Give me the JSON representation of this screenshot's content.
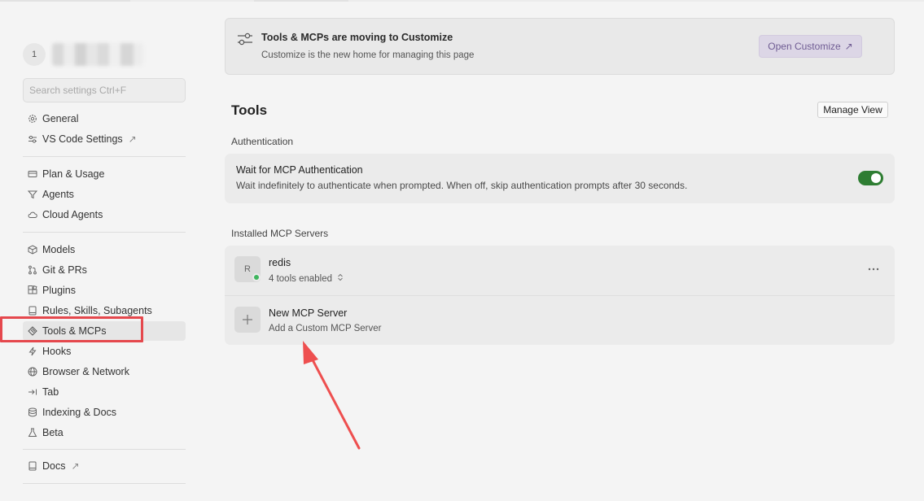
{
  "user": {
    "avatar_initial": "1"
  },
  "search": {
    "placeholder": "Search settings Ctrl+F"
  },
  "sidebar": {
    "items": [
      {
        "label": "General",
        "icon": "gear-icon"
      },
      {
        "label": "VS Code Settings",
        "icon": "settings-sliders-icon",
        "external": "↗"
      },
      {
        "label": "Plan & Usage",
        "icon": "card-icon"
      },
      {
        "label": "Agents",
        "icon": "funnel-icon"
      },
      {
        "label": "Cloud Agents",
        "icon": "cloud-icon"
      },
      {
        "label": "Models",
        "icon": "cube-icon"
      },
      {
        "label": "Git & PRs",
        "icon": "git-icon"
      },
      {
        "label": "Plugins",
        "icon": "plugin-icon"
      },
      {
        "label": "Rules, Skills, Subagents",
        "icon": "book-icon"
      },
      {
        "label": "Tools & MCPs",
        "icon": "tools-icon",
        "active": true
      },
      {
        "label": "Hooks",
        "icon": "lightning-icon"
      },
      {
        "label": "Browser & Network",
        "icon": "globe-icon"
      },
      {
        "label": "Tab",
        "icon": "tab-arrow-icon"
      },
      {
        "label": "Indexing & Docs",
        "icon": "database-icon"
      },
      {
        "label": "Beta",
        "icon": "flask-icon"
      },
      {
        "label": "Docs",
        "icon": "book-icon",
        "external": "↗"
      }
    ]
  },
  "banner": {
    "title": "Tools & MCPs are moving to Customize",
    "subtitle": "Customize is the new home for managing this page",
    "button_label": "Open Customize",
    "button_icon": "↗"
  },
  "main": {
    "title": "Tools",
    "manage_view_label": "Manage View",
    "auth_section_label": "Authentication",
    "auth": {
      "title": "Wait for MCP Authentication",
      "description": "Wait indefinitely to authenticate when prompted. When off, skip authentication prompts after 30 seconds.",
      "enabled": true
    },
    "servers_section_label": "Installed MCP Servers",
    "servers": [
      {
        "initial": "R",
        "name": "redis",
        "subtitle": "4 tools enabled",
        "status": "online"
      }
    ],
    "new_server": {
      "title": "New MCP Server",
      "subtitle": "Add a Custom MCP Server"
    }
  },
  "colors": {
    "accent_purple": "#6f5c93",
    "toggle_on": "#2e7d32",
    "status_online": "#3fb55e",
    "annotation_red": "#e5484d"
  }
}
